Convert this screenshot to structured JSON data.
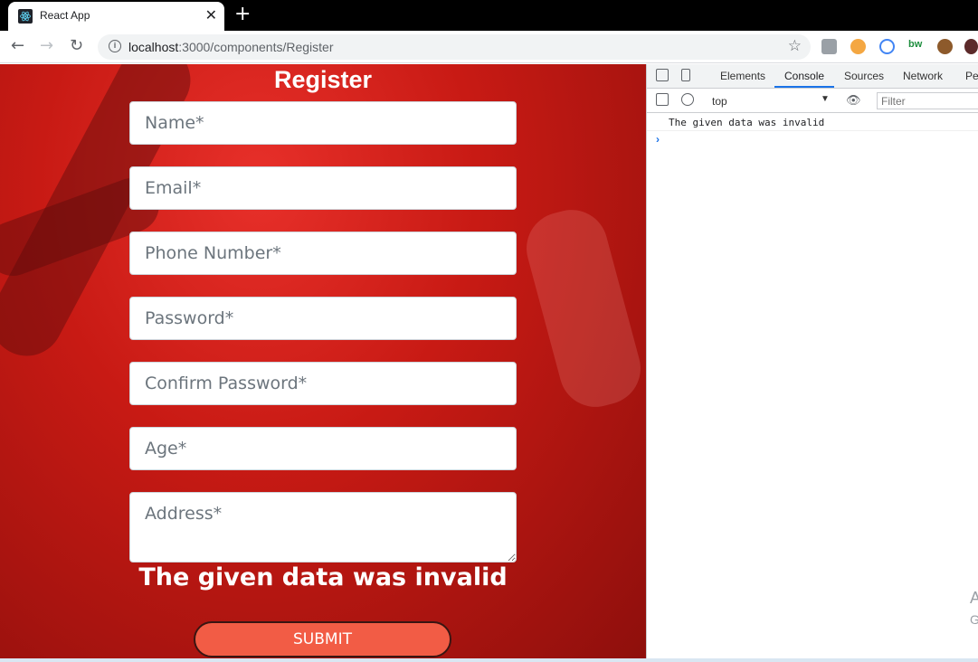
{
  "browser": {
    "tab_title": "React App",
    "url_host": "localhost",
    "url_rest": ":3000/components/Register"
  },
  "page": {
    "title": "Register",
    "fields": {
      "name": "Name*",
      "email": "Email*",
      "phone": "Phone Number*",
      "password": "Password*",
      "confirm_password": "Confirm Password*",
      "age": "Age*",
      "address": "Address*"
    },
    "error": "The given data was invalid",
    "submit_label": "SUBMIT",
    "colors": {
      "background": "#c81a14",
      "submit": "#f25c45"
    }
  },
  "devtools": {
    "tabs": [
      "Elements",
      "Console",
      "Sources",
      "Network",
      "Per"
    ],
    "active_tab": "Console",
    "context": "top",
    "filter_placeholder": "Filter",
    "messages": [
      "The given data was invalid"
    ],
    "prompt": "›",
    "watermark": "A",
    "watermark2": "G"
  }
}
